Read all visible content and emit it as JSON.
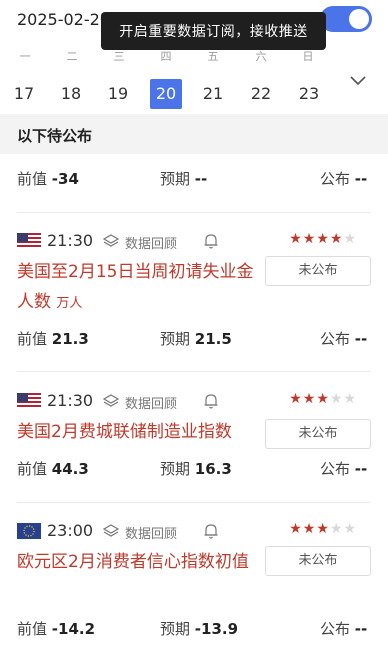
{
  "header": {
    "date": "2025-02-20",
    "tooltip": "开启重要数据订阅，接收推送",
    "toggle_on": true
  },
  "week": {
    "weekday_labels": [
      "一",
      "二",
      "三",
      "四",
      "五",
      "六",
      "日"
    ],
    "days": [
      "17",
      "18",
      "19",
      "20",
      "21",
      "22",
      "23"
    ],
    "selected_day": "20"
  },
  "section": {
    "title": "以下待公布"
  },
  "partial_row": {
    "prev_label": "前值",
    "prev_value": "-34",
    "forecast_label": "预期",
    "forecast_value": "--",
    "publish_label": "公布",
    "publish_value": "--"
  },
  "events": [
    {
      "flag": "us-flag",
      "time": "21:30",
      "review": "数据回顾",
      "stars": 4,
      "title": "美国至2月15日当周初请失业金人数",
      "unit": "万人",
      "status": "未公布",
      "prev_label": "前值",
      "prev_value": "21.3",
      "forecast_label": "预期",
      "forecast_value": "21.5",
      "publish_label": "公布",
      "publish_value": "--"
    },
    {
      "flag": "us-flag",
      "time": "21:30",
      "review": "数据回顾",
      "stars": 3,
      "title": "美国2月费城联储制造业指数",
      "unit": "",
      "status": "未公布",
      "prev_label": "前值",
      "prev_value": "44.3",
      "forecast_label": "预期",
      "forecast_value": "16.3",
      "publish_label": "公布",
      "publish_value": "--"
    },
    {
      "flag": "eu-flag",
      "time": "23:00",
      "review": "数据回顾",
      "stars": 3,
      "title": "欧元区2月消费者信心指数初值",
      "unit": "",
      "status": "未公布",
      "prev_label": "前值",
      "prev_value": "-14.2",
      "forecast_label": "预期",
      "forecast_value": "-13.9",
      "publish_label": "公布",
      "publish_value": "--"
    }
  ],
  "colors": {
    "accent": "#4a74e8",
    "importance": "#c0392b",
    "tooltip_bg": "#1f1f1f"
  }
}
